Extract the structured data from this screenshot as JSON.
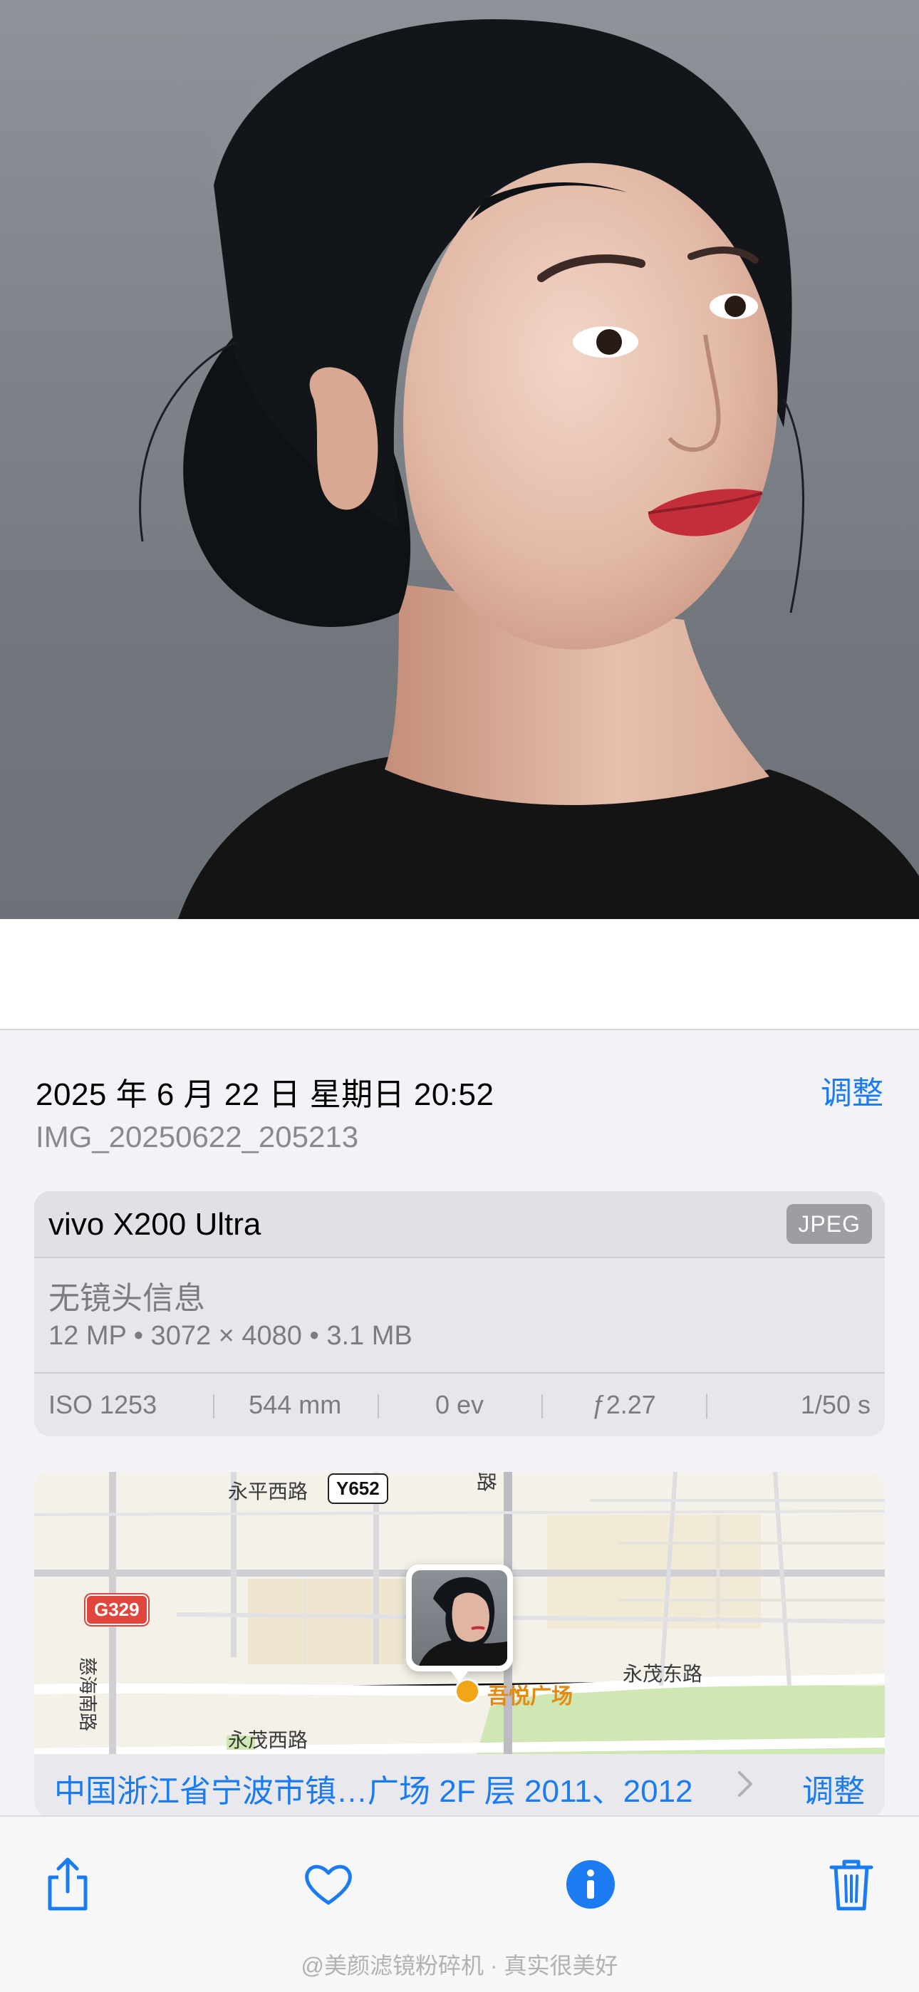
{
  "photo": {
    "subject": "portrait"
  },
  "info": {
    "datetime": "2025 年 6 月 22 日 星期日 20:52",
    "filename": "IMG_20250622_205213",
    "adjust_label": "调整"
  },
  "metadata": {
    "camera": "vivo X200 Ultra",
    "format": "JPEG",
    "lens": "无镜头信息",
    "specs": "12 MP • 3072 × 4080 • 3.1 MB",
    "exif": {
      "iso": "ISO 1253",
      "focal": "544 mm",
      "ev": "0 ev",
      "aperture": "ƒ2.27",
      "shutter": "1/50 s"
    }
  },
  "map": {
    "roads": {
      "yongping": "永平西路",
      "cihai": "慈海南路",
      "yongmao_west": "永茂西路",
      "yongmao_east": "永茂东路",
      "vertical_top": "路"
    },
    "shields": {
      "y652": "Y652",
      "g329": "G329"
    },
    "poi": "吾悦广场",
    "location": "中国浙江省宁波市镇…广场 2F 层 2011、2012",
    "adjust_label": "调整"
  },
  "toolbar": {
    "share": "share-icon",
    "favorite": "heart-icon",
    "info": "info-icon",
    "delete": "trash-icon",
    "accent": "#1a7cf0"
  },
  "watermark": "@美颜滤镜粉碎机 · 真实很美好"
}
